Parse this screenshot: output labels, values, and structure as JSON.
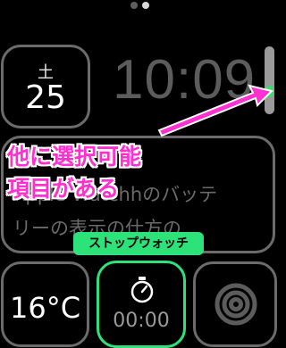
{
  "page_indicator": {
    "count": 2,
    "active_index": 1
  },
  "date_complication": {
    "weekday": "土",
    "day": "25"
  },
  "time": "10:09",
  "info_complication": {
    "line1": "",
    "line2": "Apple Watchhのバッテ",
    "line3": "リーの表示の仕方の..."
  },
  "annotation": {
    "text": "他に選択可能\n項目がある",
    "color": "#ff2fd0"
  },
  "callout_label": "ストップウォッチ",
  "temperature_complication": {
    "value": "16°C"
  },
  "stopwatch_complication": {
    "icon": "stopwatch-icon",
    "time": "00:00"
  },
  "activity_complication": {
    "icon": "activity-rings-icon"
  },
  "colors": {
    "accent": "#2ee27a",
    "crown": "#32e06a"
  }
}
